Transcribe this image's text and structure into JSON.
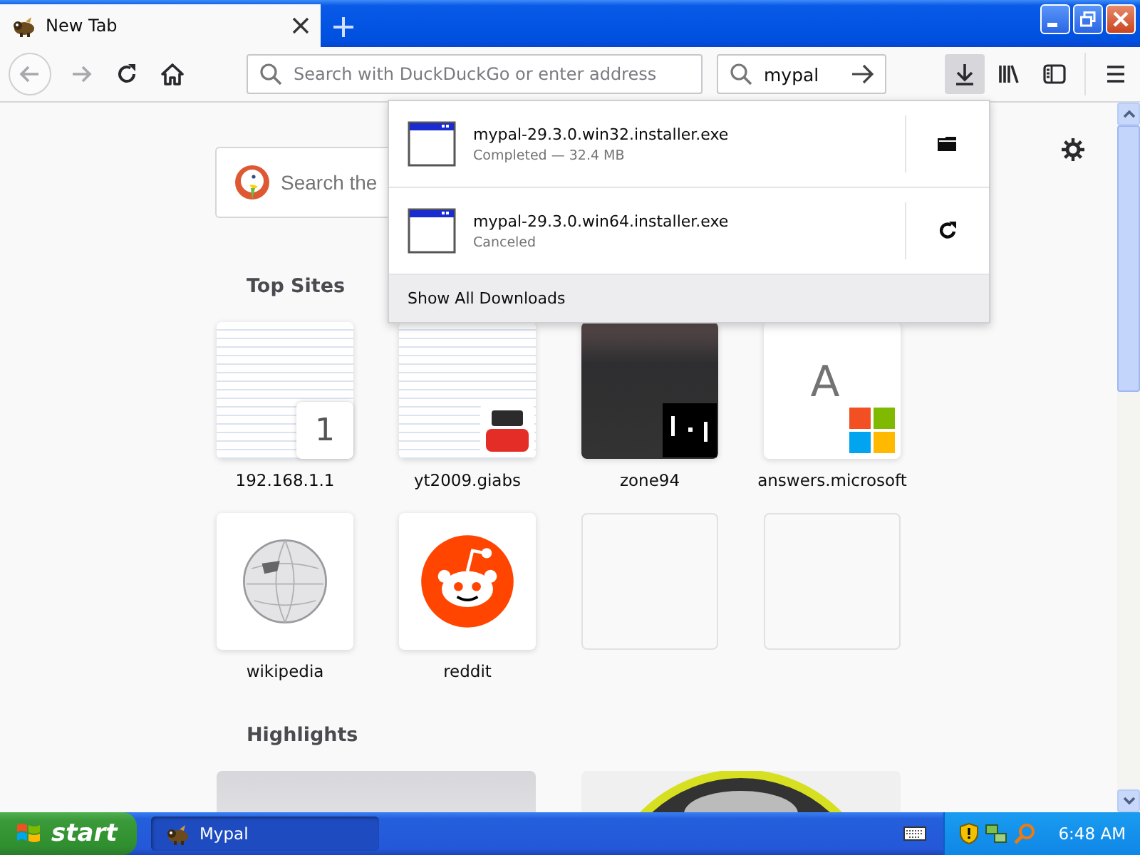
{
  "window": {
    "tabs": [
      {
        "title": "New Tab",
        "selected": true
      }
    ]
  },
  "toolbar": {
    "address": {
      "placeholder": "Search with DuckDuckGo or enter address"
    },
    "search": {
      "value": "mypal"
    },
    "downloads_open": true
  },
  "downloads_panel": {
    "items": [
      {
        "filename": "mypal-29.3.0.win32.installer.exe",
        "status": "Completed — 32.4 MB",
        "kind": "completed"
      },
      {
        "filename": "mypal-29.3.0.win64.installer.exe",
        "status": "Canceled",
        "kind": "canceled"
      }
    ],
    "footer": "Show All Downloads"
  },
  "new_tab": {
    "search": {
      "placeholder": "Search the"
    },
    "top_sites": {
      "title": "Top Sites",
      "tiles": [
        {
          "label": "192.168.1.1",
          "kind": "screenshot",
          "badge": "1"
        },
        {
          "label": "yt2009.giabs",
          "kind": "screenshot",
          "logo": {
            "kind": "youtube"
          }
        },
        {
          "label": "zone94",
          "kind": "dark-screenshot",
          "logo": {
            "kind": "pong"
          }
        },
        {
          "label": "answers.microsoft",
          "kind": "letter",
          "letter": "A",
          "logo": {
            "kind": "windows"
          }
        },
        {
          "label": "wikipedia",
          "kind": "icon",
          "logo": {
            "kind": "globe"
          }
        },
        {
          "label": "reddit",
          "kind": "icon",
          "logo": {
            "kind": "reddit"
          }
        },
        {
          "kind": "empty"
        },
        {
          "kind": "empty"
        }
      ]
    },
    "highlights": {
      "title": "Highlights"
    }
  },
  "taskbar": {
    "start": "start",
    "tasks": [
      {
        "label": "Mypal",
        "selected": true
      }
    ],
    "clock": "6:48 AM"
  }
}
